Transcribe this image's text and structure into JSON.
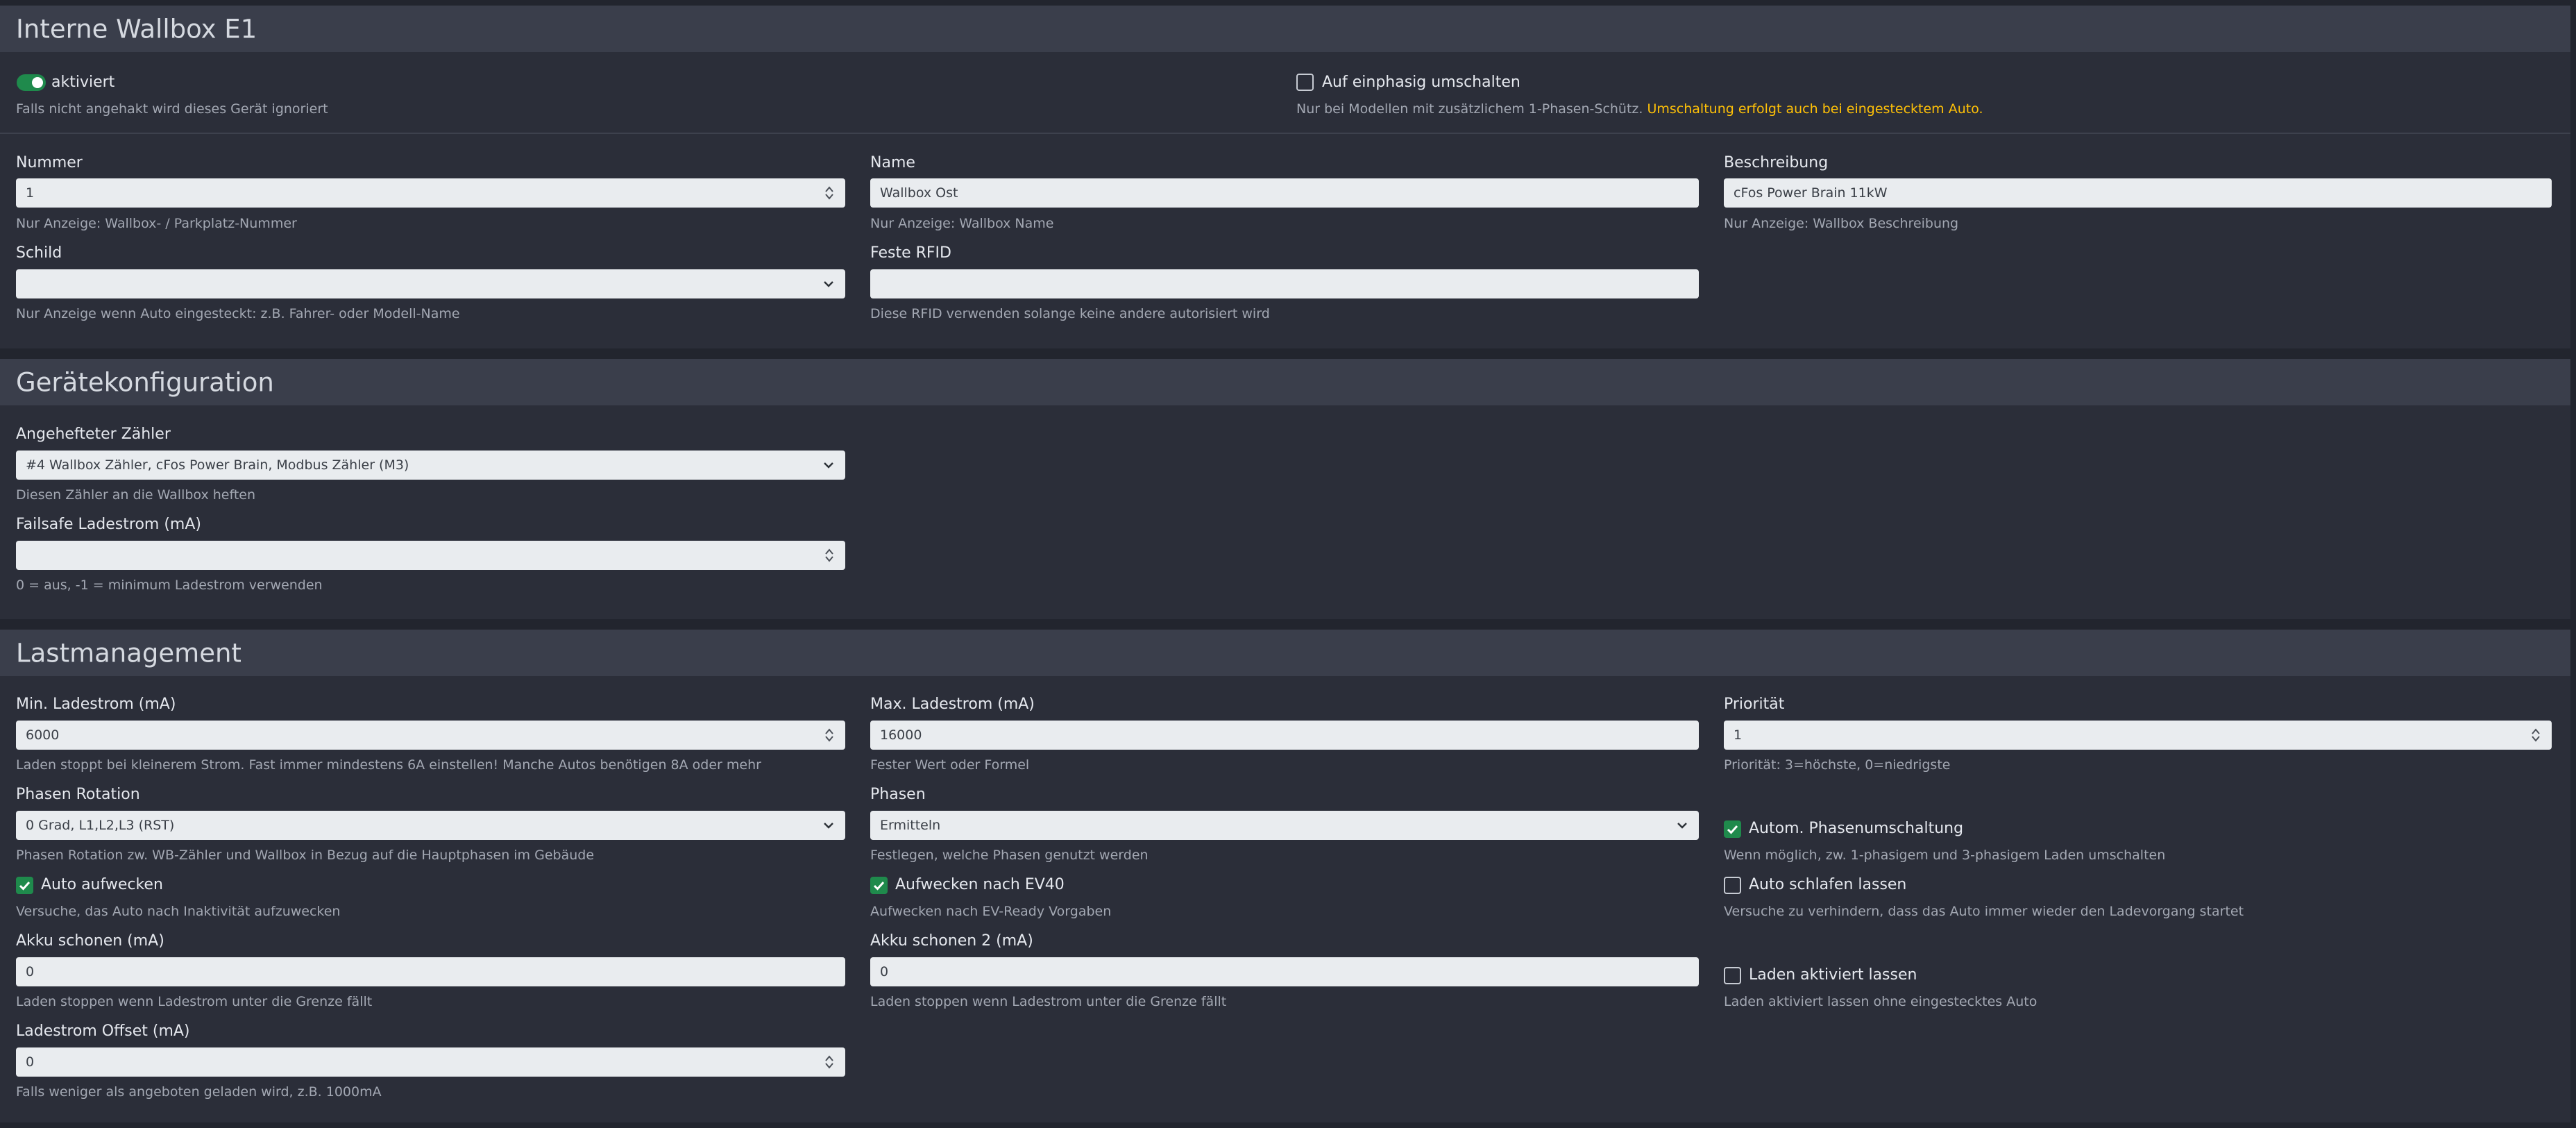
{
  "sections": {
    "wallbox": {
      "title": "Interne Wallbox E1",
      "enabled": {
        "label": "aktiviert",
        "checked": true,
        "help": "Falls nicht angehakt wird dieses Gerät ignoriert"
      },
      "single_phase": {
        "label": "Auf einphasig umschalten",
        "checked": false,
        "help": "Nur bei Modellen mit zusätzlichem 1-Phasen-Schütz.",
        "warning": "Umschaltung erfolgt auch bei eingestecktem Auto."
      },
      "number": {
        "label": "Nummer",
        "value": "1",
        "help": "Nur Anzeige: Wallbox- / Parkplatz-Nummer"
      },
      "name": {
        "label": "Name",
        "value": "Wallbox Ost",
        "help": "Nur Anzeige: Wallbox Name"
      },
      "description": {
        "label": "Beschreibung",
        "value": "cFos Power Brain 11kW",
        "help": "Nur Anzeige: Wallbox Beschreibung"
      },
      "sign": {
        "label": "Schild",
        "value": "",
        "help": "Nur Anzeige wenn Auto eingesteckt: z.B. Fahrer- oder Modell-Name"
      },
      "rfid": {
        "label": "Feste RFID",
        "value": "",
        "help": "Diese RFID verwenden solange keine andere autorisiert wird"
      }
    },
    "device_config": {
      "title": "Gerätekonfiguration",
      "meter": {
        "label": "Angehefteter Zähler",
        "value": "#4 Wallbox Zähler, cFos Power Brain, Modbus Zähler (M3)",
        "help": "Diesen Zähler an die Wallbox heften"
      },
      "failsafe": {
        "label": "Failsafe Ladestrom (mA)",
        "value": "",
        "help": "0 = aus, -1 = minimum Ladestrom verwenden"
      }
    },
    "load_mgmt": {
      "title": "Lastmanagement",
      "min_current": {
        "label": "Min. Ladestrom (mA)",
        "value": "6000",
        "help": "Laden stoppt bei kleinerem Strom. Fast immer mindestens 6A einstellen! Manche Autos benötigen 8A oder mehr"
      },
      "max_current": {
        "label": "Max. Ladestrom (mA)",
        "value": "16000",
        "help": "Fester Wert oder Formel"
      },
      "priority": {
        "label": "Priorität",
        "value": "1",
        "help": "Priorität: 3=höchste, 0=niedrigste"
      },
      "phase_rotation": {
        "label": "Phasen Rotation",
        "value": "0 Grad, L1,L2,L3 (RST)",
        "help": "Phasen Rotation zw. WB-Zähler und Wallbox in Bezug auf die Hauptphasen im Gebäude"
      },
      "phases": {
        "label": "Phasen",
        "value": "Ermitteln",
        "help": "Festlegen, welche Phasen genutzt werden"
      },
      "auto_phase_switch": {
        "label": "Autom. Phasenumschaltung",
        "checked": true,
        "help": "Wenn möglich, zw. 1-phasigem und 3-phasigem Laden umschalten"
      },
      "wake_car": {
        "label": "Auto aufwecken",
        "checked": true,
        "help": "Versuche, das Auto nach Inaktivität aufzuwecken"
      },
      "wake_ev40": {
        "label": "Aufwecken nach EV40",
        "checked": true,
        "help": "Aufwecken nach EV-Ready Vorgaben"
      },
      "let_sleep": {
        "label": "Auto schlafen lassen",
        "checked": false,
        "help": "Versuche zu verhindern, dass das Auto immer wieder den Ladevorgang startet"
      },
      "battery_save": {
        "label": "Akku schonen (mA)",
        "value": "0",
        "help": "Laden stoppen wenn Ladestrom unter die Grenze fällt"
      },
      "battery_save2": {
        "label": "Akku schonen 2 (mA)",
        "value": "0",
        "help": "Laden stoppen wenn Ladestrom unter die Grenze fällt"
      },
      "keep_enabled": {
        "label": "Laden aktiviert lassen",
        "checked": false,
        "help": "Laden aktiviert lassen ohne eingestecktes Auto"
      },
      "offset": {
        "label": "Ladestrom Offset (mA)",
        "value": "0",
        "help": "Falls weniger als angeboten geladen wird, z.B. 1000mA"
      }
    }
  },
  "icons": {
    "spinner": "spinner-arrows-icon",
    "select": "chevron-down-icon",
    "check": "checkmark-icon"
  },
  "colors": {
    "accent": "#1f8a4c",
    "warning": "#ffc107",
    "panel": "#2b2e39",
    "header": "#3a3e4b"
  }
}
